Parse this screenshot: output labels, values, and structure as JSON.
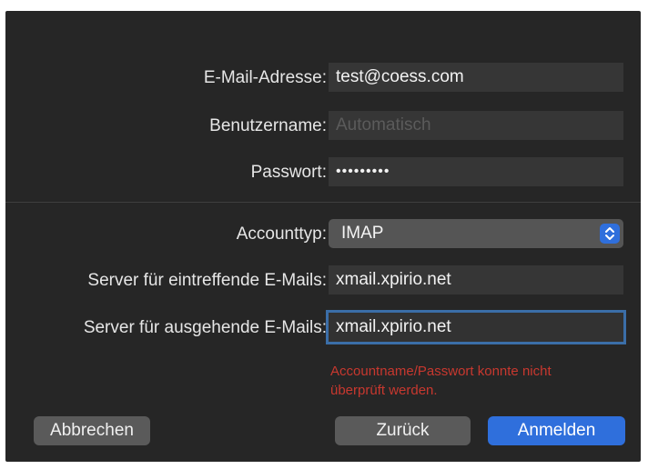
{
  "form": {
    "email_label": "E-Mail-Adresse:",
    "email_value": "test@coess.com",
    "username_label": "Benutzername:",
    "username_placeholder": "Automatisch",
    "password_label": "Passwort:",
    "password_value": "•••••••••",
    "account_type_label": "Accounttyp:",
    "account_type_value": "IMAP",
    "incoming_label": "Server für eintreffende E-Mails:",
    "incoming_value": "xmail.xpirio.net",
    "outgoing_label": "Server für ausgehende E-Mails:",
    "outgoing_value": "xmail.xpirio.net",
    "error_line1": "Accountname/Passwort konnte nicht",
    "error_line2": "überprüft werden."
  },
  "buttons": {
    "cancel": "Abbrechen",
    "back": "Zurück",
    "sign_in": "Anmelden"
  },
  "colors": {
    "dialog_bg": "#262626",
    "field_bg": "#363636",
    "accent": "#2f6fdc",
    "error": "#c8382f",
    "focus_ring": "#3b6ea8"
  },
  "icons": {
    "select_arrows": "updown-chevron-icon"
  }
}
